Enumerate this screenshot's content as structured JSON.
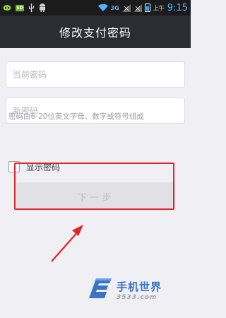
{
  "status_bar": {
    "sd_label": "SD",
    "network": "3G",
    "ampm": "上午",
    "time": "9:15",
    "icons": [
      "game-icon",
      "sms-icon",
      "sd-card-icon",
      "usb-icon",
      "android-icon",
      "wifi-icon",
      "signal-icon",
      "battery-icon"
    ]
  },
  "header": {
    "title": "修改支付密码"
  },
  "form": {
    "current_placeholder": "当前密码",
    "new_placeholder": "新密码",
    "hint": "密码由6-20位英文字母、数字或符号组成",
    "show_password_label": "显示密码",
    "show_password_checked": false,
    "next_label": "下一步"
  },
  "annotation": {
    "highlight_color": "#e0262a"
  },
  "watermark": {
    "line1": "手机世界",
    "line2": "3533.com"
  }
}
